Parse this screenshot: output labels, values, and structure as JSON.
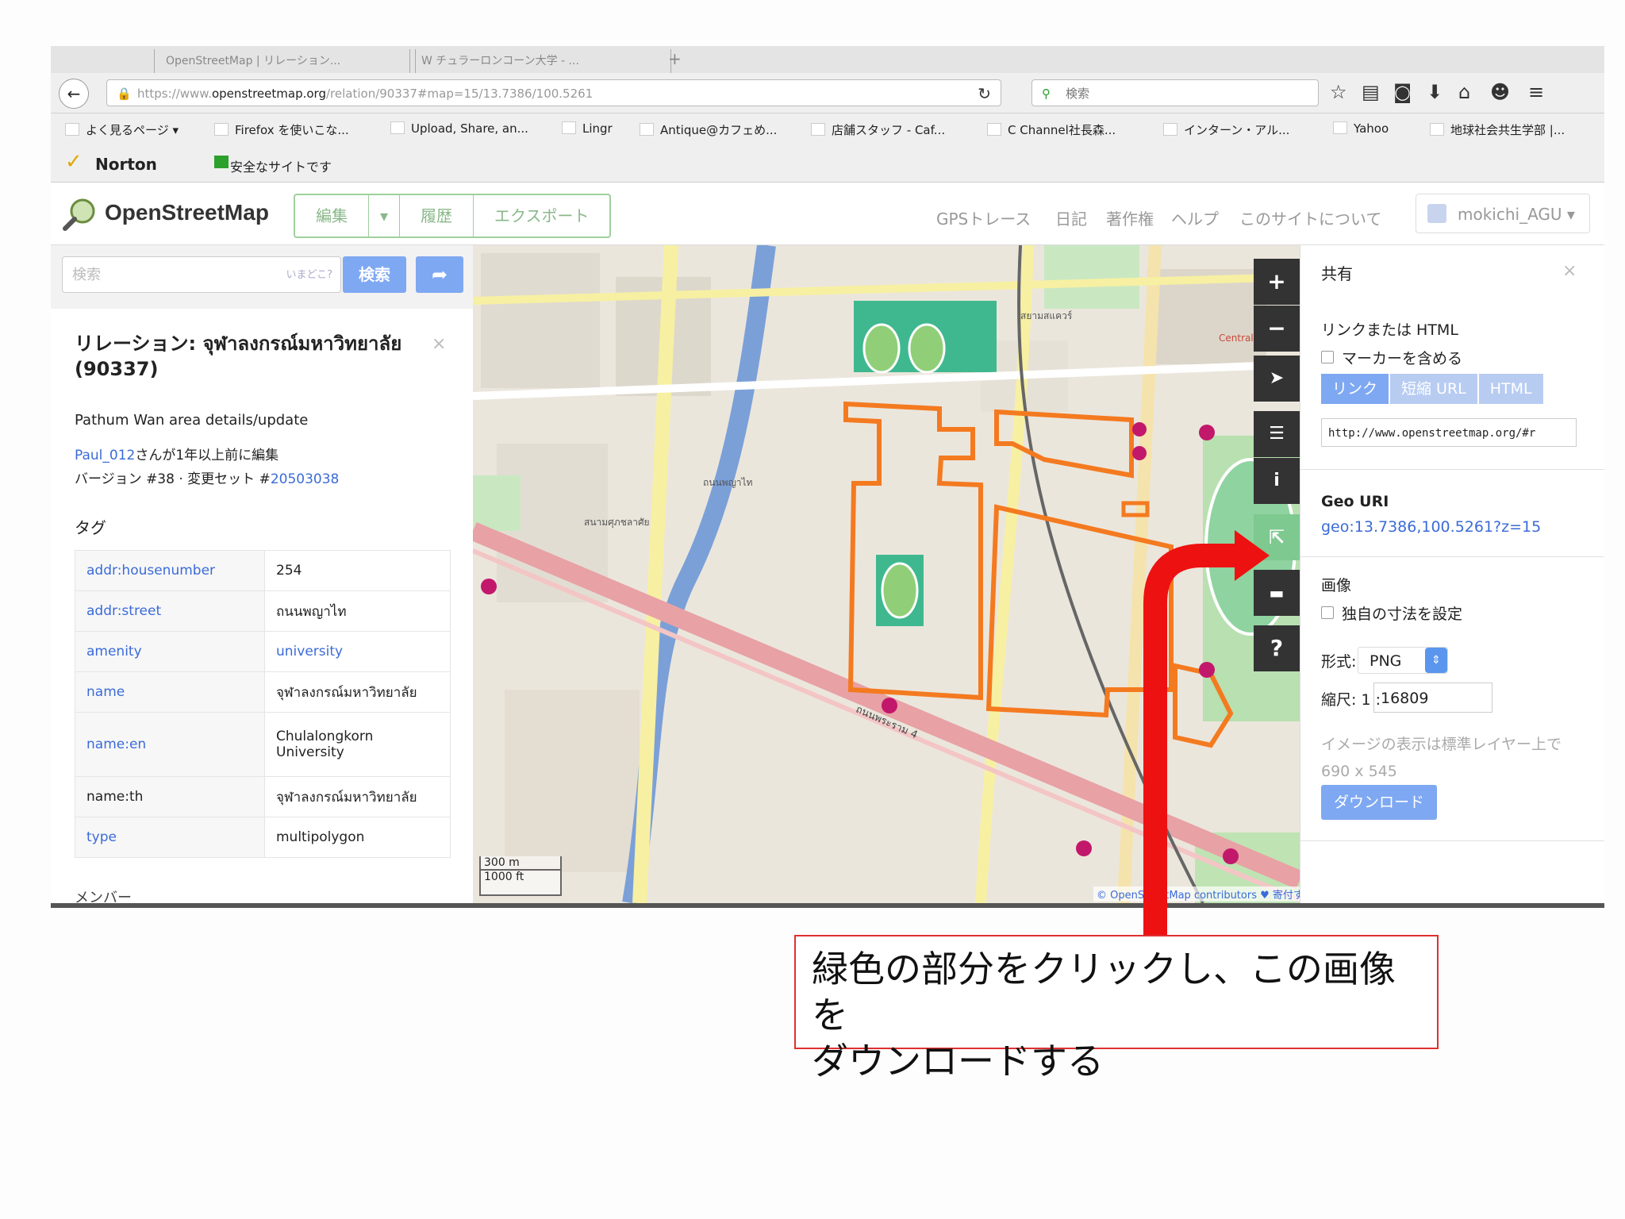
{
  "browser": {
    "tabs": [
      "OpenStreetMap | リレーション...",
      "W  チュラーロンコーン大学 - ..."
    ],
    "url_prefix": "https://www.",
    "url_domain": "openstreetmap.org",
    "url_rest": "/relation/90337#map=15/13.7386/100.5261",
    "search_placeholder": "検索",
    "bookmarks": [
      "よく見るページ ▾",
      "Firefox を使いこな...",
      "Upload, Share, an...",
      "Lingr",
      "Antique@カフェめ...",
      "店舗スタッフ - Caf...",
      "C Channel社長森...",
      "インターン・アル...",
      "Yahoo",
      "地球社会共生学部 |..."
    ],
    "norton_label": "Norton",
    "norton_safe": "安全なサイトです"
  },
  "osm": {
    "logo": "OpenStreetMap",
    "edit": "編集",
    "history": "履歴",
    "export": "エクスポート",
    "nav": [
      "GPSトレース",
      "日記",
      "著作権",
      "ヘルプ",
      "このサイトについて"
    ],
    "user": "mokichi_AGU"
  },
  "sidebar": {
    "search_placeholder": "検索",
    "where_am_i": "いまどこ?",
    "search_button": "検索",
    "title": "リレーション: จุฬาลงกรณ์มหาวิทยาลัย (90337)",
    "description": "Pathum Wan area details/update",
    "edited_by_user": "Paul_012",
    "edited_by_suffix": "さんが1年以上前に編集",
    "version_prefix": "バージョン #38 · 変更セット #",
    "changeset": "20503038",
    "tags_heading": "タグ",
    "tags": [
      {
        "k": "addr:housenumber",
        "v": "254"
      },
      {
        "k": "addr:street",
        "v": "ถนนพญาไท"
      },
      {
        "k": "amenity",
        "v": "university"
      },
      {
        "k": "name",
        "v": "จุฬาลงกรณ์มหาวิทยาลัย"
      },
      {
        "k": "name:en",
        "v": "Chulalongkorn University"
      },
      {
        "k": "name:th",
        "v": "จุฬาลงกรณ์มหาวิทยาลัย"
      },
      {
        "k": "type",
        "v": "multipolygon"
      }
    ],
    "members_heading": "メンバー"
  },
  "map": {
    "scale_m": "300 m",
    "scale_ft": "1000 ft",
    "attribution": "© OpenStreetMap contributors ♥ 寄付する",
    "labels": [
      "Central World",
      "ถนนพญาไท",
      "สนามศุภชลาศัย",
      "สยามสแควร์",
      "ถนนพระราม 4"
    ]
  },
  "share": {
    "title": "共有",
    "link_heading": "リンクまたは HTML",
    "include_marker": "マーカーを含める",
    "tabs": [
      "リンク",
      "短縮 URL",
      "HTML"
    ],
    "link_value": "http://www.openstreetmap.org/#r",
    "geo_heading": "Geo URI",
    "geo_value": "geo:13.7386,100.5261?z=15",
    "image_heading": "画像",
    "custom_size": "独自の寸法を設定",
    "format_label": "形式:",
    "format_value": "PNG",
    "scale_label": "縮尺:  1 :",
    "scale_value": "16809",
    "note": "イメージの表示は標準レイヤー上で 690 x 545",
    "download": "ダウンロード"
  },
  "annotation": {
    "line1": "緑色の部分をクリックし、この画像を",
    "line2": "ダウンロードする",
    "arrow_color": "#ee1111"
  }
}
